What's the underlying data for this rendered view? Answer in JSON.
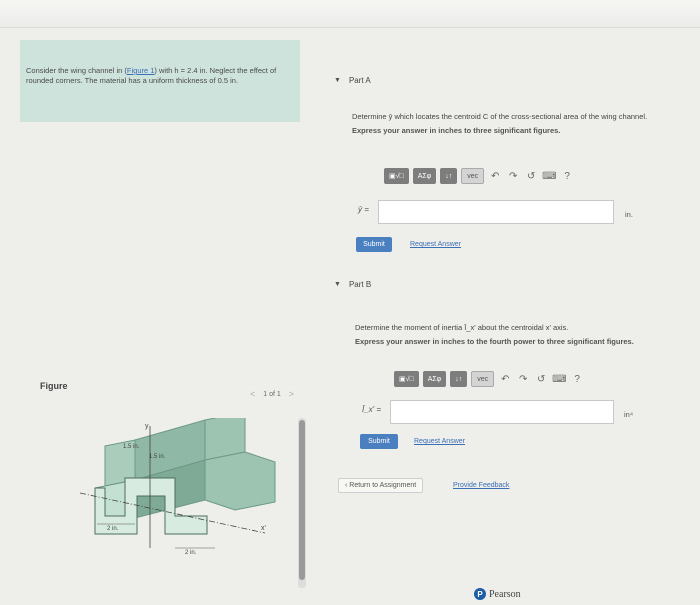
{
  "problem": {
    "text_before_link": "Consider the wing channel in (",
    "link_text": "Figure 1",
    "text_after_link": ") with h = 2.4 in. Neglect the effect of rounded corners. The material has a uniform thickness of 0.5 in."
  },
  "figure": {
    "label": "Figure",
    "pager": "1 of 1",
    "prev_symbol": "<",
    "next_symbol": ">",
    "dim_labels": {
      "top_left": "1.5 in.",
      "top_mid": "1.5 in.",
      "bottom_left": "2 in.",
      "bottom_mid": "2 in."
    },
    "axis_labels": {
      "y": "y",
      "x_prime": "x'"
    }
  },
  "partA": {
    "title": "Part A",
    "question": "Determine ȳ which locates the centroid C of the cross-sectional area of the wing channel.",
    "instruction": "Express your answer in inches to three significant figures.",
    "var_label": "ȳ =",
    "unit": "in.",
    "submit": "Submit",
    "request": "Request Answer"
  },
  "partB": {
    "title": "Part B",
    "question": "Determine the moment of inertia Ī_x' about the centroidal x' axis.",
    "instruction": "Express your answer in inches to the fourth power to three significant figures.",
    "var_label": "Ī_x' =",
    "unit": "in⁴",
    "submit": "Submit",
    "request": "Request Answer"
  },
  "toolbar": {
    "templates": "▣√□",
    "greek": "ΑΣφ",
    "arrows": "↓↑",
    "vec": "vec",
    "undo": "↶",
    "redo": "↷",
    "reset": "↺",
    "keyboard": "⌨",
    "help": "?"
  },
  "nav": {
    "return": "‹ Return to Assignment",
    "feedback": "Provide Feedback"
  },
  "brand": {
    "logo_letter": "P",
    "name": "Pearson"
  }
}
